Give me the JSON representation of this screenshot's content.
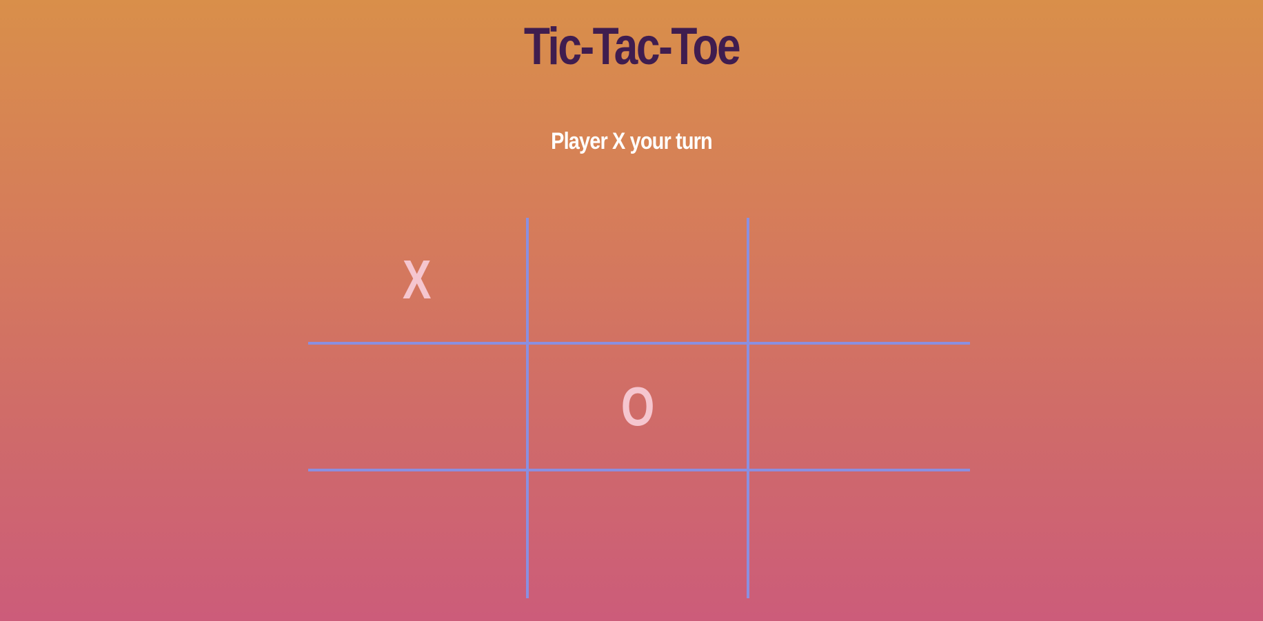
{
  "title": "Tic-Tac-Toe",
  "status_text": "Player X your turn",
  "board": [
    [
      "X",
      "",
      ""
    ],
    [
      "",
      "O",
      ""
    ],
    [
      "",
      "",
      ""
    ]
  ],
  "colors": {
    "title": "#3f1d4f",
    "status": "#ffffff",
    "grid": "#8a8fe0",
    "mark": "#f5c6cf"
  }
}
